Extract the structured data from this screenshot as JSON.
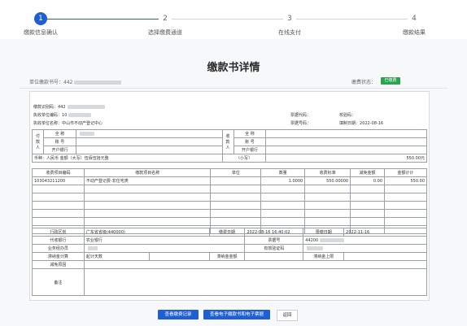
{
  "stepper": {
    "steps": [
      {
        "num": "1",
        "label": "缴款信息确认"
      },
      {
        "num": "2",
        "label": "选择缴费通道"
      },
      {
        "num": "3",
        "label": "在线支付"
      },
      {
        "num": "4",
        "label": "缴款结果"
      }
    ]
  },
  "page": {
    "title": "缴款书详情",
    "unit_code_label": "单位缴款书号：",
    "unit_code_value": "442",
    "status_label": "缴费状态：",
    "status_value": "已缴费"
  },
  "doc": {
    "notice_no_label": "缴款识别码：",
    "notice_no_value": "442",
    "unit_code_label": "执收单位编码：",
    "unit_code_value": "10",
    "unit_name_label": "执收单位名称：",
    "unit_name_value": "中山市不动产登记中心",
    "ticket_code_label": "票据代码：",
    "ticket_code_value": "校验码：",
    "ticket_no_label": "票据号码：",
    "fill_date_label": "填制日期：",
    "fill_date_value": "2022-08-16"
  },
  "payer": {
    "side_label": "付款人",
    "name_label": "全 称",
    "account_label": "账 号",
    "bank_label": "开户银行"
  },
  "payee": {
    "side_label": "收款人",
    "name_label": "全 称",
    "account_label": "账 号",
    "bank_label": "开户银行"
  },
  "amount_row": {
    "label": "币种：人民币  金额（大写）伍佰伍拾元整",
    "small_label": "（小写）",
    "small_value": "550.00元"
  },
  "items": {
    "headers": [
      "收费项目编码",
      "缴款项目名称",
      "单位",
      "数量",
      "收费标准",
      "减免金额",
      "金额计计"
    ],
    "rows": [
      [
        "103043211200",
        "不动产登记费-非住宅类",
        "",
        "1.0000",
        "550.00000",
        "0.00",
        "550.00"
      ]
    ]
  },
  "details": {
    "region_label": "行政区划",
    "region_value": "广东省省级(440000)",
    "created_label": "缴费日期",
    "created_value": "2022-08-16 16:40:02",
    "deadline_label": "限缴日期",
    "deadline_value": "2022-11-16",
    "bank_label": "代收银行",
    "bank_value": "农业银行",
    "ticket_no_label": "票据号",
    "ticket_no_value": "44200",
    "handler_label": "业务经办员",
    "id_label": "有效验证码",
    "late_label": "滞纳金计算",
    "late_days_label": "起计天数",
    "late_fee_label": "滞纳金金额",
    "late_limit_label": "滞纳金上限",
    "reduce_label": "减免原因",
    "remark_label": "备注"
  },
  "buttons": {
    "records": "查看缴费记录",
    "einvoice": "查看电子缴款书和电子票据",
    "back": "返回"
  }
}
